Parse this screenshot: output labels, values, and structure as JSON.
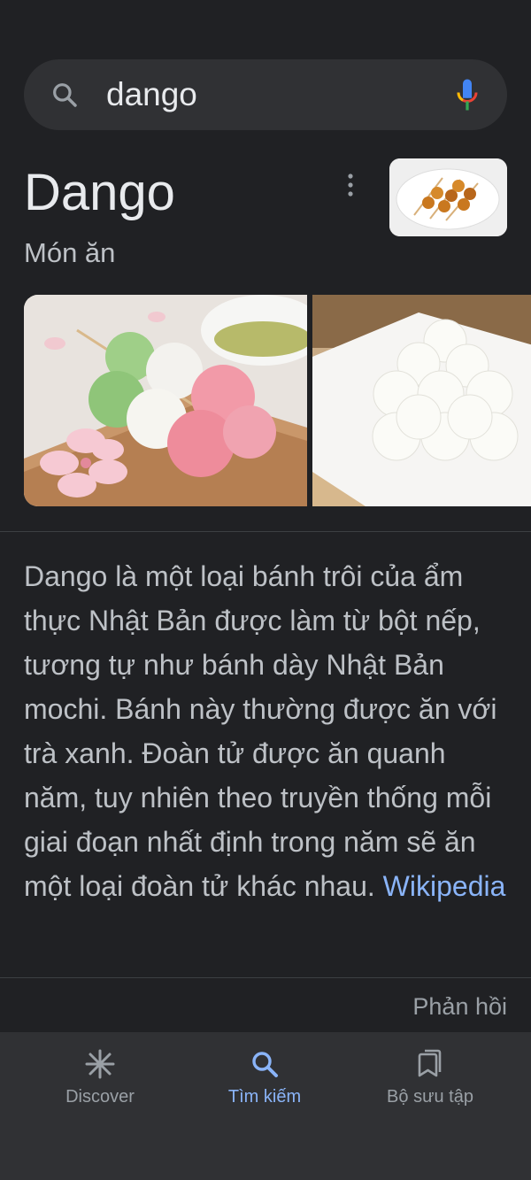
{
  "search": {
    "query": "dango",
    "icons": [
      "search-icon",
      "mic-icon"
    ]
  },
  "knowledge_panel": {
    "title": "Dango",
    "subtitle": "Món ăn",
    "thumbnail_icon": "dango-thumbnail-image",
    "images": [
      "dango-skewer-photo",
      "dango-pyramid-photo"
    ],
    "description": "Dango là một loại bánh trôi của ẩm thực Nhật Bản được làm từ bột nếp, tương tự như bánh dày Nhật Bản mochi. Bánh này thường được ăn với trà xanh. Đoàn tử được ăn quanh năm, tuy nhiên theo truyền thống mỗi giai đoạn nhất định trong năm sẽ ăn một loại đoàn tử khác nhau.",
    "source_link": "Wikipedia",
    "feedback": "Phản hồi"
  },
  "bottom_nav": {
    "discover": "Discover",
    "search": "Tìm kiếm",
    "collections": "Bộ sưu tập"
  },
  "colors": {
    "background": "#202124",
    "surface": "#303134",
    "accent": "#8ab4f8",
    "text_primary": "#e8eaed",
    "text_secondary": "#bdc1c6"
  }
}
